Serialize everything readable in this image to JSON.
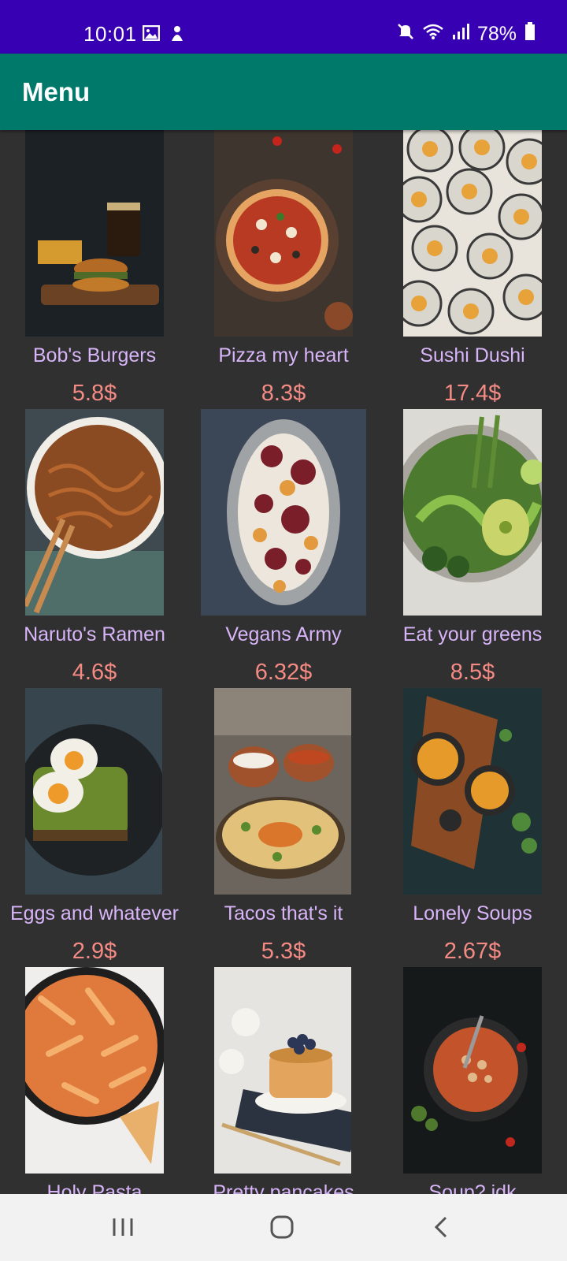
{
  "status_bar": {
    "time": "10:01",
    "battery": "78%",
    "left_icons": [
      "image-icon",
      "notification-icon"
    ],
    "right_icons": [
      "mute-icon",
      "wifi-icon",
      "signal-icon",
      "battery-icon"
    ]
  },
  "app_bar": {
    "title": "Menu"
  },
  "menu": {
    "items": [
      {
        "name": "Bob's Burgers",
        "price": "5.8$",
        "image": "burger-photo"
      },
      {
        "name": "Pizza my heart",
        "price": "8.3$",
        "image": "pizza-photo"
      },
      {
        "name": "Sushi Dushi",
        "price": "17.4$",
        "image": "sushi-photo"
      },
      {
        "name": "Naruto's Ramen",
        "price": "4.6$",
        "image": "ramen-photo"
      },
      {
        "name": "Vegans Army",
        "price": "6.32$",
        "image": "vegan-plate-photo"
      },
      {
        "name": "Eat your greens",
        "price": "8.5$",
        "image": "greens-bowl-photo"
      },
      {
        "name": "Eggs and whatever",
        "price": "2.9$",
        "image": "eggs-toast-photo"
      },
      {
        "name": "Tacos that's it",
        "price": "5.3$",
        "image": "tacos-photo"
      },
      {
        "name": "Lonely Soups",
        "price": "2.67$",
        "image": "soups-photo"
      },
      {
        "name": "Holy Pasta",
        "price": "",
        "image": "pasta-photo"
      },
      {
        "name": "Pretty pancakes",
        "price": "",
        "image": "pancakes-photo"
      },
      {
        "name": "Soup? idk",
        "price": "",
        "image": "soup-bowl-photo"
      }
    ]
  },
  "nav_bar": {
    "buttons": [
      "recents-icon",
      "home-icon",
      "back-icon"
    ]
  }
}
